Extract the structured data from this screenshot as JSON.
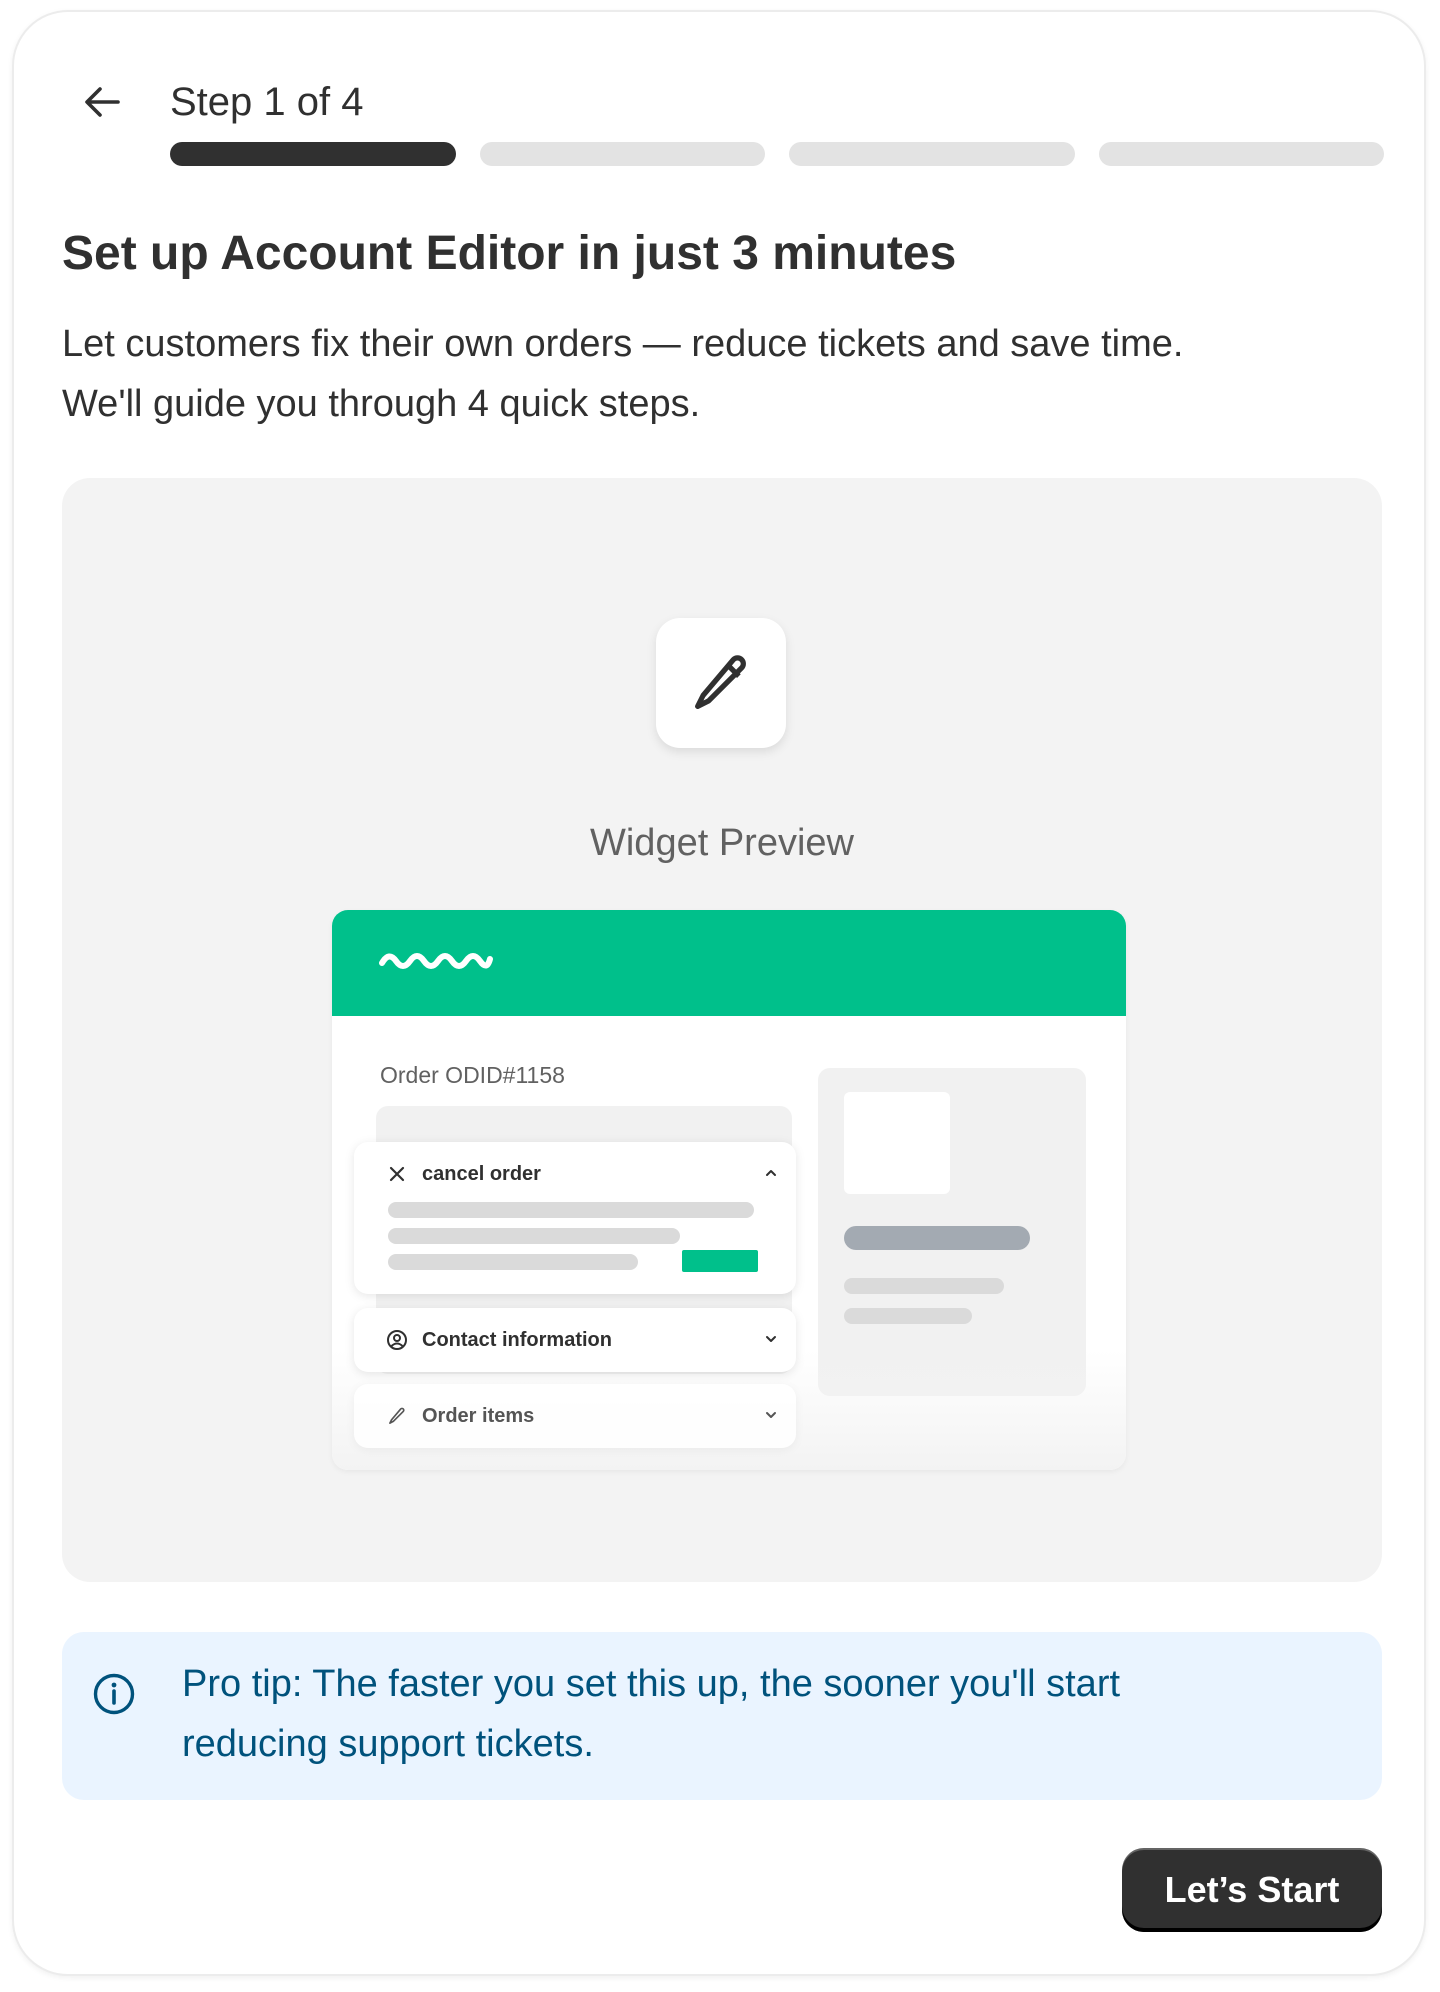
{
  "header": {
    "step_label": "Step 1 of 4",
    "back_icon": "arrow-left-icon",
    "progress": {
      "current_step": 1,
      "total_steps": 4
    }
  },
  "intro": {
    "title": "Set up Account Editor in just 3 minutes",
    "line1": "Let customers fix their own orders — reduce tickets and save time.",
    "line2": "We'll guide you through 4 quick steps."
  },
  "preview": {
    "icon": "pencil-icon",
    "label": "Widget Preview",
    "widget": {
      "brand_color": "#00c08b",
      "logo_icon": "wave-logo-icon",
      "order_id": "Order ODID#1158",
      "accordions": [
        {
          "icon": "close-icon",
          "label": "cancel order",
          "state": "expanded"
        },
        {
          "icon": "user-circle-icon",
          "label": "Contact information",
          "state": "collapsed"
        },
        {
          "icon": "pencil-icon",
          "label": "Order items",
          "state": "collapsed"
        }
      ]
    }
  },
  "tip": {
    "icon": "info-icon",
    "line1": "Pro tip: The faster you set this up, the sooner you'll start",
    "line2": "reducing support tickets.",
    "text_color": "#00527c",
    "background": "#eaf4ff"
  },
  "actions": {
    "start_label": "Let’s Start"
  },
  "colors": {
    "text": "#303030",
    "accent_green": "#00c08b",
    "progress_active": "#303030",
    "progress_inactive": "#e3e3e3"
  }
}
